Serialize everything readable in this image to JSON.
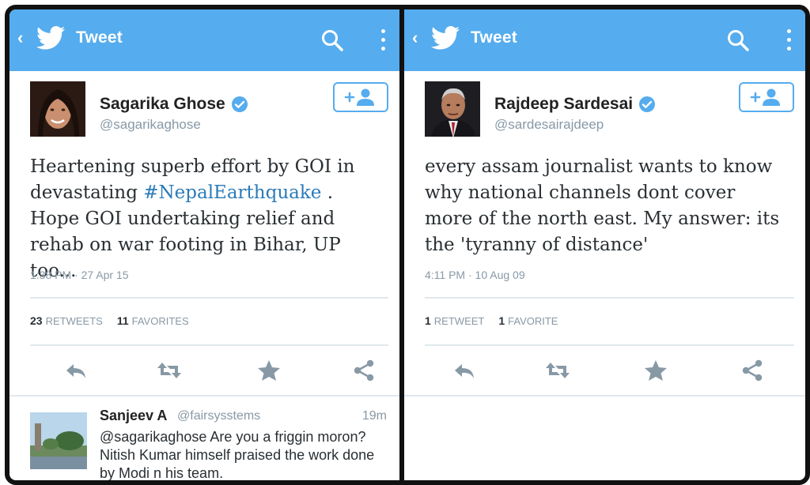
{
  "colors": {
    "accent": "#55acee",
    "text": "#292f33",
    "muted": "#8899a6",
    "link": "#2b7bb9"
  },
  "panels": [
    {
      "bar_title": "Tweet",
      "name": "Sagarika Ghose",
      "handle": "@sagarikaghose",
      "text_before": "Heartening superb effort by GOI in devastating ",
      "hashtag": "#NepalEarthquake",
      "text_after": " . Hope GOI undertaking relief and rehab on war footing in Bihar, UP too...",
      "timestamp": "1:38 PM · 27 Apr 15",
      "retweets_count": "23",
      "retweets_label": "RETWEETS",
      "favorites_count": "11",
      "favorites_label": "FAVORITES",
      "reply": {
        "name": "Sanjeev A",
        "handle": "@fairsysstems",
        "time": "19m",
        "text": "@sagarikaghose Are you a friggin moron? Nitish Kumar himself praised the work done by Modi n his team."
      }
    },
    {
      "bar_title": "Tweet",
      "name": "Rajdeep Sardesai",
      "handle": "@sardesairajdeep",
      "text_before": "every assam journalist wants to know why national channels dont cover more of  the north east. My answer: its the 'tyranny of distance'",
      "hashtag": "",
      "text_after": "",
      "timestamp": "4:11 PM · 10 Aug 09",
      "retweets_count": "1",
      "retweets_label": "RETWEET",
      "favorites_count": "1",
      "favorites_label": "FAVORITE"
    }
  ],
  "icons": [
    "back-icon",
    "twitter-bird-icon",
    "search-icon",
    "overflow-menu-icon",
    "verified-badge-icon",
    "follow-icon",
    "reply-icon",
    "retweet-icon",
    "favorite-star-icon",
    "share-icon"
  ]
}
